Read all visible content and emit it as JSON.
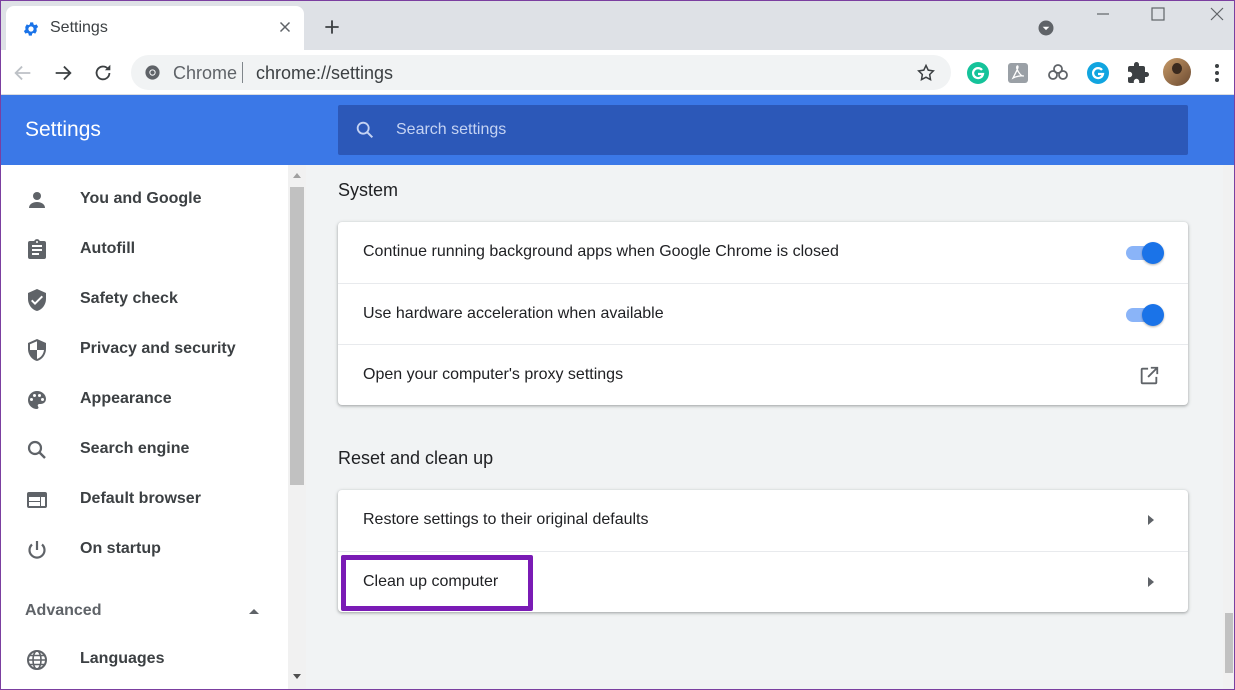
{
  "browser": {
    "tab_title": "Settings",
    "omnibox_site": "Chrome",
    "omnibox_url": "chrome://settings"
  },
  "header": {
    "title": "Settings",
    "search_placeholder": "Search settings"
  },
  "sidebar": {
    "items": [
      {
        "label": "You and Google",
        "icon": "person-icon"
      },
      {
        "label": "Autofill",
        "icon": "clipboard-icon"
      },
      {
        "label": "Safety check",
        "icon": "shield-check-icon"
      },
      {
        "label": "Privacy and security",
        "icon": "shield-half-icon"
      },
      {
        "label": "Appearance",
        "icon": "palette-icon"
      },
      {
        "label": "Search engine",
        "icon": "search-icon"
      },
      {
        "label": "Default browser",
        "icon": "browser-window-icon"
      },
      {
        "label": "On startup",
        "icon": "power-icon"
      }
    ],
    "advanced_label": "Advanced",
    "languages_label": "Languages"
  },
  "main": {
    "system": {
      "title": "System",
      "rows": [
        {
          "label": "Continue running background apps when Google Chrome is closed",
          "control": "toggle",
          "enabled": true
        },
        {
          "label": "Use hardware acceleration when available",
          "control": "toggle",
          "enabled": true
        },
        {
          "label": "Open your computer's proxy settings",
          "control": "external-link"
        }
      ]
    },
    "reset": {
      "title": "Reset and clean up",
      "rows": [
        {
          "label": "Restore settings to their original defaults",
          "control": "arrow"
        },
        {
          "label": "Clean up computer",
          "control": "arrow",
          "highlighted": true
        }
      ]
    }
  },
  "colors": {
    "header_blue": "#3b78e7",
    "search_blue": "#2c58b8",
    "toggle_on": "#1a73e8",
    "highlight_purple": "#7a1bb5"
  }
}
